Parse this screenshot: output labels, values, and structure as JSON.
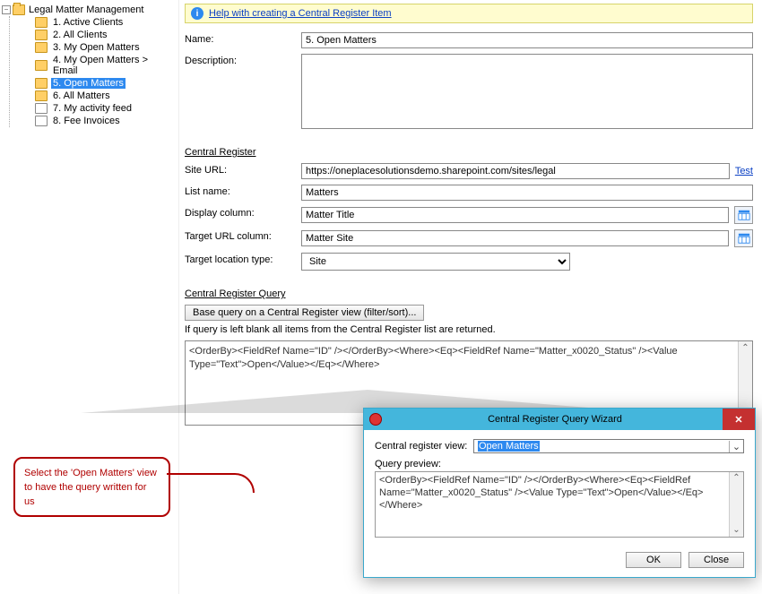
{
  "tree": {
    "root": "Legal Matter Management",
    "items": [
      "1. Active Clients",
      "2. All Clients",
      "3. My Open Matters",
      "4. My Open Matters > Email",
      "5. Open Matters",
      "6. All Matters",
      "7. My activity feed",
      "8. Fee Invoices"
    ],
    "selectedIndex": 4
  },
  "help": {
    "link": "Help with creating a Central Register Item"
  },
  "labels": {
    "name": "Name:",
    "description": "Description:",
    "central_register": "Central Register",
    "site_url": "Site URL:",
    "list_name": "List name:",
    "display_column": "Display column:",
    "target_url_column": "Target URL column:",
    "target_location_type": "Target location type:",
    "central_register_query": "Central Register Query",
    "base_query_btn": "Base query on a Central Register view (filter/sort)...",
    "blank_hint": "If query is left blank all items from the Central Register list are returned.",
    "test": "Test"
  },
  "values": {
    "name": "5. Open Matters",
    "description": "",
    "site_url": "https://oneplacesolutionsdemo.sharepoint.com/sites/legal",
    "list_name": "Matters",
    "display_column": "Matter Title",
    "target_url_column": "Matter Site",
    "target_location_type": "Site",
    "query": "<OrderBy><FieldRef Name=\"ID\" /></OrderBy><Where><Eq><FieldRef Name=\"Matter_x0020_Status\" /><Value Type=\"Text\">Open</Value></Eq></Where>"
  },
  "callout": "Select the 'Open Matters' view to have the query written for us",
  "dialog": {
    "title": "Central Register Query Wizard",
    "view_label": "Central register view:",
    "view_value": "Open Matters",
    "preview_label": "Query preview:",
    "preview": "<OrderBy><FieldRef Name=\"ID\" /></OrderBy><Where><Eq><FieldRef Name=\"Matter_x0020_Status\" /><Value Type=\"Text\">Open</Value></Eq></Where>",
    "ok": "OK",
    "close": "Close"
  }
}
